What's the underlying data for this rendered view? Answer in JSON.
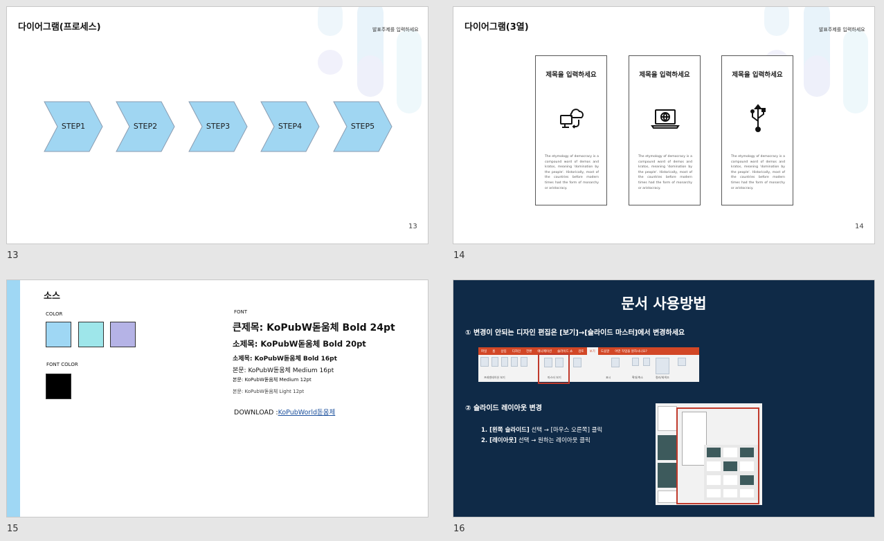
{
  "slides": [
    {
      "number": "13",
      "title": "다이어그램(프로세스)",
      "subtitle": "발표주제를 입력하세요",
      "page": "13",
      "steps": [
        "STEP1",
        "STEP2",
        "STEP3",
        "STEP4",
        "STEP5"
      ]
    },
    {
      "number": "14",
      "title": "다이어그램(3열)",
      "subtitle": "발표주제를 입력하세요",
      "page": "14",
      "cards": [
        {
          "title": "제목을 입력하세요",
          "icon": "cloud-computer-icon",
          "body": "The etymology of democracy is a compound word of demos and kratos, meaning 'domination by the people'. Historically, most of the countries before modern times had the form of monarchy or aristocracy."
        },
        {
          "title": "제목을 입력하세요",
          "icon": "laptop-globe-icon",
          "body": "The etymology of democracy is a compound word of demos and kratos, meaning 'domination by the people'. Historically, most of the countries before modern times had the form of monarchy or aristocracy."
        },
        {
          "title": "제목을 입력하세요",
          "icon": "usb-icon",
          "body": "The etymology of democracy is a compound word of demos and kratos, meaning 'domination by the people'. Historically, most of the countries before modern times had the form of monarchy or aristocracy."
        }
      ]
    },
    {
      "number": "15",
      "title": "소스",
      "color_label": "COLOR",
      "colors": [
        "#9fd7f4",
        "#9ee6ea",
        "#b5b3e6"
      ],
      "font_color_label": "FONT COLOR",
      "font_color": "#000000",
      "font_label": "FONT",
      "font_lines": [
        "큰제목: KoPubW돋움체 Bold 24pt",
        "소제목: KoPubW돋움체 Bold 20pt",
        "소제목: KoPubW돋움체 Bold 16pt",
        "본문: KoPubW돋움체 Medium 16pt",
        "본문: KoPubW돋움체 Medium 12pt",
        "본문: KoPubW돋움체 Light 12pt"
      ],
      "download_label": "DOWNLOAD :",
      "download_link": "KoPubWorld돋움체"
    },
    {
      "number": "16",
      "title": "문서 사용방법",
      "step1": "① 변경이 안되는 디자인 편집은 [보기]→[슬라이드 마스터]에서 변경하세요",
      "step2": "② 슬라이드 레이아웃 변경",
      "instr1_bold": "1. [왼쪽 슬라이드]",
      "instr1_rest": " 선택 → [마우스 오른쪽] 클릭",
      "instr2_bold": "2. [레이아웃]",
      "instr2_rest": " 선택 → 원하는 레이아웃 클릭",
      "ribbon_tabs": [
        "파일",
        "홈",
        "삽입",
        "디자인",
        "전환",
        "애니메이션",
        "슬라이드 쇼",
        "검토",
        "보기",
        "도움말",
        "어떤 작업을 원하시나요?"
      ],
      "ribbon_items": [
        "기본",
        "개요 보기",
        "여러 슬라이드",
        "슬라이드 노트",
        "읽기용 보기",
        "슬라이드 마스터",
        "유인물 마스터",
        "슬라이드 노트 마스터",
        "눈금자",
        "눈금선",
        "안내선",
        "슬라이드 노트",
        "확대/축소",
        "창에 맞춤",
        "컬러",
        "회색조",
        "흑백",
        "새 창"
      ],
      "ribbon_groups": [
        "프레젠테이션 보기",
        "마스터 보기",
        "표시",
        "확대/축소",
        "컬러/회색조"
      ],
      "accent": "#c0392b",
      "bg": "#0f2a47"
    }
  ]
}
